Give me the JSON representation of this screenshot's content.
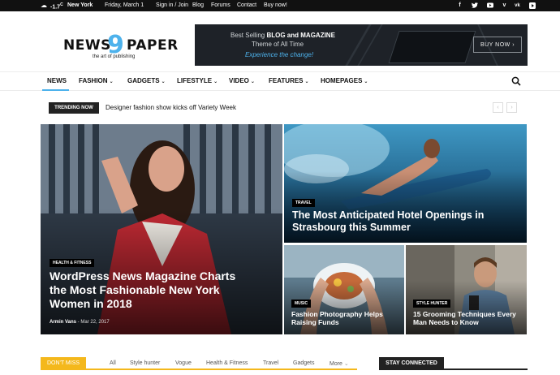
{
  "topbar": {
    "temperature": "-1.7",
    "temp_unit": "C",
    "city": "New York",
    "date": "Friday, March 1",
    "sign_in": "Sign in / Join",
    "links": [
      "Blog",
      "Forums",
      "Contact",
      "Buy now!"
    ],
    "social": [
      "f",
      "t",
      "▶",
      "v",
      "vk",
      "▶"
    ]
  },
  "logo": {
    "part1": "NEWS",
    "part2": "9",
    "part3": "PAPER",
    "tagline": "the art of publishing"
  },
  "banner": {
    "line1_pre": "Best Selling ",
    "line1_bold": "BLOG and MAGAZINE",
    "line2": "Theme of All Time",
    "line3": "Experience the change!",
    "cta": "BUY NOW ›"
  },
  "nav": {
    "items": [
      "NEWS",
      "FASHION",
      "GADGETS",
      "LIFESTYLE",
      "VIDEO",
      "FEATURES",
      "HOMEPAGES"
    ],
    "dropdown_chevron": "⌄"
  },
  "trending": {
    "label": "TRENDING NOW",
    "headline": "Designer fashion show kicks off Variety Week",
    "prev": "‹",
    "next": "›"
  },
  "featured": [
    {
      "category": "HEALTH & FITNESS",
      "title": "WordPress News Magazine Charts the Most Fashionable New York Women in 2018",
      "author": "Armin Vans",
      "date": "Mar 22, 2017"
    },
    {
      "category": "TRAVEL",
      "title": "The Most Anticipated Hotel Openings in Strasbourg this Summer"
    },
    {
      "category": "MUSIC",
      "title": "Fashion Photography Helps Raising Funds"
    },
    {
      "category": "STYLE HUNTER",
      "title": "15 Grooming Techniques Every Man Needs to Know"
    }
  ],
  "dont_miss": {
    "label": "DON'T MISS",
    "filters": [
      "All",
      "Style hunter",
      "Vogue",
      "Health & Fitness",
      "Travel",
      "Gadgets",
      "More"
    ],
    "more_chevron": "⌄"
  },
  "stay_connected": {
    "label": "STAY CONNECTED"
  },
  "colors": {
    "accent": "#4db2ec",
    "dont_miss": "#f4b81c",
    "dark": "#111111"
  }
}
